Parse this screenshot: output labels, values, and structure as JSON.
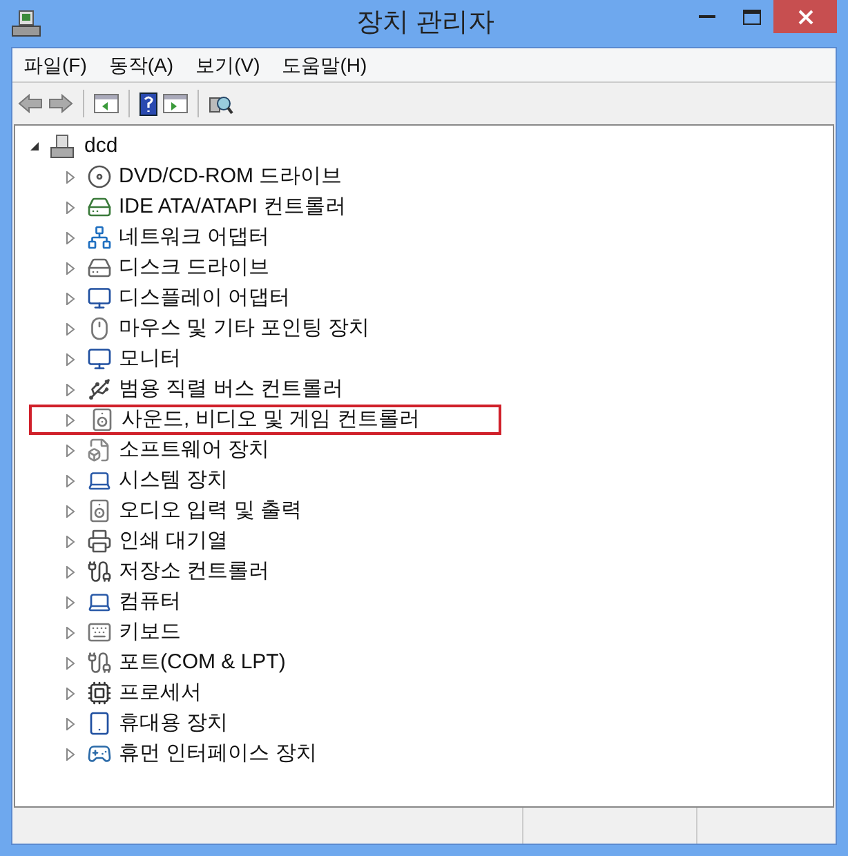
{
  "window": {
    "title": "장치 관리자"
  },
  "menu": [
    "파일(F)",
    "동작(A)",
    "보기(V)",
    "도움말(H)"
  ],
  "tree": {
    "label": "dcd",
    "expanded": true,
    "children": [
      {
        "label": "DVD/CD-ROM 드라이브",
        "expanded": false,
        "highlighted": false
      },
      {
        "label": "IDE ATA/ATAPI 컨트롤러",
        "expanded": false,
        "highlighted": false
      },
      {
        "label": "네트워크 어댑터",
        "expanded": false,
        "highlighted": false
      },
      {
        "label": "디스크 드라이브",
        "expanded": false,
        "highlighted": false
      },
      {
        "label": "디스플레이 어댑터",
        "expanded": false,
        "highlighted": false
      },
      {
        "label": "마우스 및 기타 포인팅 장치",
        "expanded": false,
        "highlighted": false
      },
      {
        "label": "모니터",
        "expanded": false,
        "highlighted": false
      },
      {
        "label": "범용 직렬 버스 컨트롤러",
        "expanded": false,
        "highlighted": false
      },
      {
        "label": "사운드, 비디오 및 게임 컨트롤러",
        "expanded": false,
        "highlighted": true
      },
      {
        "label": "소프트웨어 장치",
        "expanded": false,
        "highlighted": false
      },
      {
        "label": "시스템 장치",
        "expanded": false,
        "highlighted": false
      },
      {
        "label": "오디오 입력 및 출력",
        "expanded": false,
        "highlighted": false
      },
      {
        "label": "인쇄 대기열",
        "expanded": false,
        "highlighted": false
      },
      {
        "label": "저장소 컨트롤러",
        "expanded": false,
        "highlighted": false
      },
      {
        "label": "컴퓨터",
        "expanded": false,
        "highlighted": false
      },
      {
        "label": "키보드",
        "expanded": false,
        "highlighted": false
      },
      {
        "label": "포트(COM & LPT)",
        "expanded": false,
        "highlighted": false
      },
      {
        "label": "프로세서",
        "expanded": false,
        "highlighted": false
      },
      {
        "label": "휴대용 장치",
        "expanded": false,
        "highlighted": false
      },
      {
        "label": "휴먼 인터페이스 장치",
        "expanded": false,
        "highlighted": false
      }
    ]
  }
}
